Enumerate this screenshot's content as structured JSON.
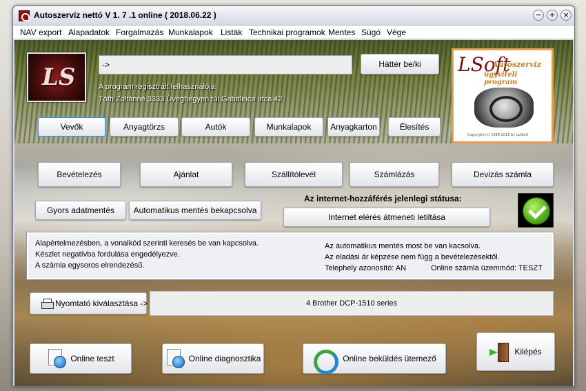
{
  "window": {
    "title": "Autoszervíz nettó  V 1. 7 .1 online   ( 2018.06.22 )",
    "controls": {
      "minimize": "−",
      "maximize": "+",
      "close": "×"
    }
  },
  "menu": [
    "NAV export",
    "Alapadatok",
    "Forgalmazás",
    "Munkalapok",
    "Listák",
    "Technikai programok",
    "Mentes",
    "Súgó",
    "Vége"
  ],
  "header": {
    "input_value": "->",
    "background_button": "Háttér be/ki",
    "registered_line": "A program regisztrált felhasználója:",
    "address_line": "Tóth Zoltánné 3333 Üveghegyen túl Gabalinca utca 42",
    "logo_glyph": "LS"
  },
  "promo": {
    "logo_glyph": "LSoft",
    "line1": "Autószerviz",
    "line2": "ügyviteli program",
    "footer": "Copyright (c) 1998-2018 by LuiSoft"
  },
  "nav_buttons": [
    "Vevők",
    "Anyagtörzs",
    "Autók",
    "Munkalapok",
    "Anyagkarton",
    "Élesítés"
  ],
  "doc_buttons": [
    "Bevételezés",
    "Ajánlat",
    "Szállítólevél",
    "Számlázás",
    "Devizás számla"
  ],
  "quick_save_button": "Gyors adatmentés",
  "auto_save_button": "Automatikus mentés bekapcsolva",
  "internet": {
    "status_title": "Az internet-hozzáférés jelenlegi státusa:",
    "disable_button": "Internet elérés átmeneti letiltása",
    "status_icon": "check-ok-icon",
    "status_color": "#4caf1d"
  },
  "info": {
    "left": [
      "Alapértelmezésben, a vonalkód szerinti keresés be van kapcsolva.",
      "Készlet negatívba fordulása engedélyezve.",
      "A számla egysoros elrendezésű."
    ],
    "right": [
      "Az automatikus mentés most be van kacsolva.",
      "Az eladási ár képzése nem függ a bevételezésektől.",
      "Telephely azonosító: AN",
      "Online számla üzemmód:  TESZT"
    ]
  },
  "printer": {
    "select_button": "Nyomtató kiválasztása ->",
    "selected": "4 Brother DCP-1510 series"
  },
  "bottom_buttons": {
    "online_test": "Online teszt",
    "online_diag": "Online diagnosztika",
    "online_send": "Online beküldés ütemező",
    "exit": "Kilépés"
  }
}
